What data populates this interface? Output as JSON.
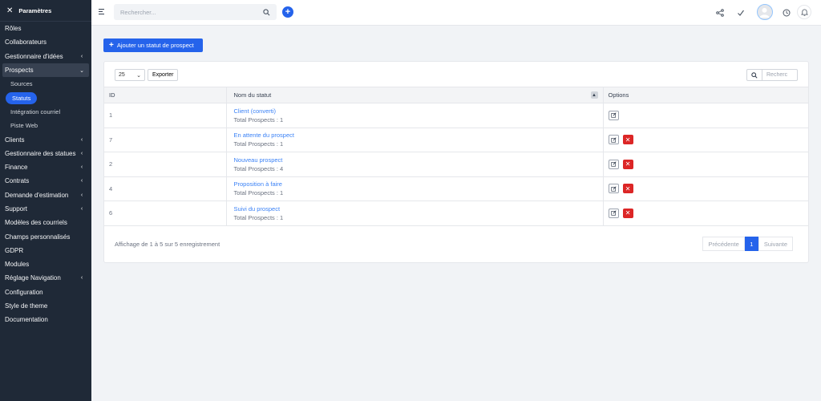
{
  "sidebar": {
    "title": "Paramètres",
    "items": [
      {
        "label": "Rôles"
      },
      {
        "label": "Collaborateurs"
      },
      {
        "label": "Gestionnaire d'idées",
        "chevron": "‹"
      },
      {
        "label": "Prospects",
        "chevron": "⌄"
      },
      {
        "label": "Sources"
      },
      {
        "label": "Statuts"
      },
      {
        "label": "Intégration courriel"
      },
      {
        "label": "Piste Web"
      },
      {
        "label": "Clients",
        "chevron": "‹"
      },
      {
        "label": "Gestionnaire des statues",
        "chevron": "‹"
      },
      {
        "label": "Finance",
        "chevron": "‹"
      },
      {
        "label": "Contrats",
        "chevron": "‹"
      },
      {
        "label": "Demande d'estimation",
        "chevron": "‹"
      },
      {
        "label": "Support",
        "chevron": "‹"
      },
      {
        "label": "Modèles des courriels"
      },
      {
        "label": "Champs personnalisés"
      },
      {
        "label": "GDPR"
      },
      {
        "label": "Modules"
      },
      {
        "label": "Réglage Navigation",
        "chevron": "‹"
      },
      {
        "label": "Configuration"
      },
      {
        "label": "Style de theme"
      },
      {
        "label": "Documentation"
      }
    ]
  },
  "header": {
    "search_placeholder": "Rechercher...",
    "add_symbol": "+"
  },
  "main": {
    "add_button": "Ajouter un statut de prospect",
    "page_size": "25",
    "export_label": "Exporter",
    "table_search_placeholder": "Recherc",
    "columns": [
      "ID",
      "Nom du statut",
      "Options"
    ],
    "rows": [
      {
        "id": "1",
        "name": "Client (converti)",
        "total": "Total Prospects : 1",
        "deletable": false
      },
      {
        "id": "7",
        "name": "En attente du prospect",
        "total": "Total Prospects : 1",
        "deletable": true
      },
      {
        "id": "2",
        "name": "Nouveau prospect",
        "total": "Total Prospects : 4",
        "deletable": true
      },
      {
        "id": "4",
        "name": "Proposition à faire",
        "total": "Total Prospects : 1",
        "deletable": true
      },
      {
        "id": "6",
        "name": "Suivi du prospect",
        "total": "Total Prospects : 1",
        "deletable": true
      }
    ],
    "footer_info": "Affichage de 1 à 5 sur 5 enregistrement",
    "pagination": {
      "prev": "Précédente",
      "current": "1",
      "next": "Suivante"
    }
  },
  "colors": {
    "accent": "#2563eb",
    "sidebar_bg": "#1f2937",
    "danger": "#dc2626",
    "link": "#3b82f6"
  }
}
